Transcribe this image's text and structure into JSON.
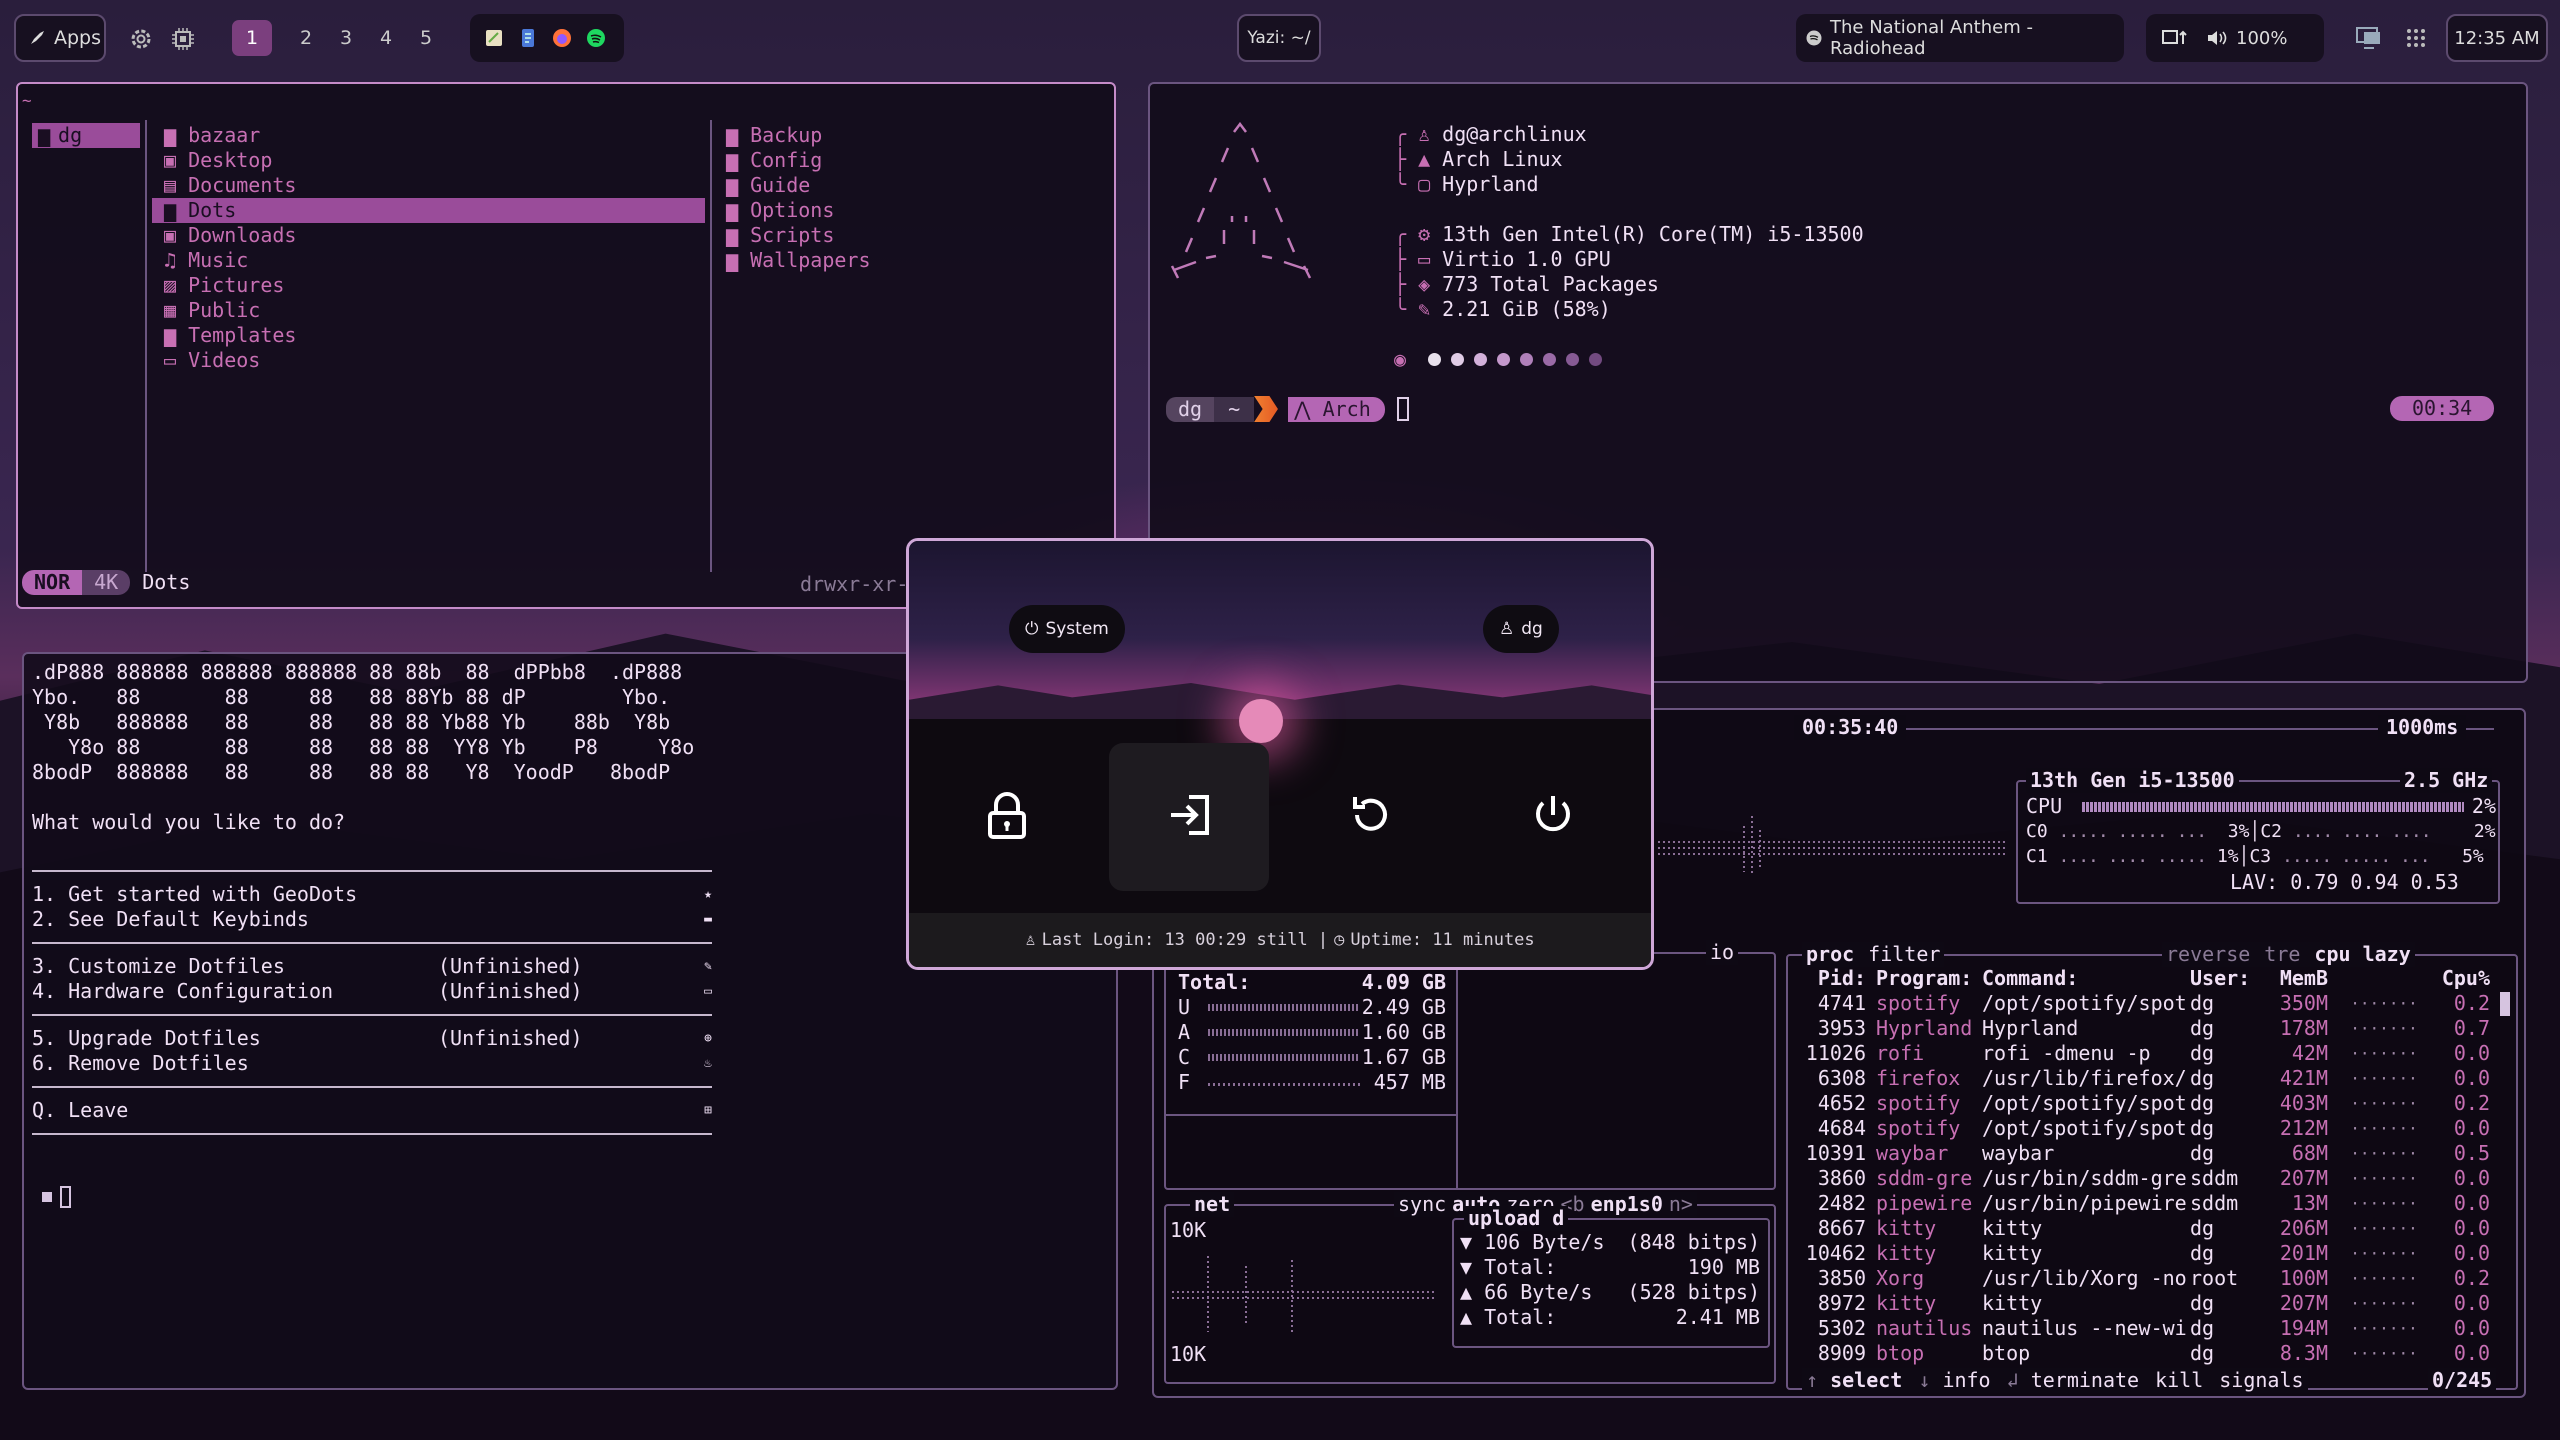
{
  "topbar": {
    "apps_label": "Apps",
    "workspaces": [
      "1",
      "2",
      "3",
      "4",
      "5"
    ],
    "active_workspace": "1",
    "window_title": "Yazi: ~/",
    "media": "The National Anthem - Radiohead",
    "volume": "100%",
    "clock": "12:35 AM"
  },
  "yazi": {
    "header": "~",
    "parent": [
      "dg"
    ],
    "current": [
      "bazaar",
      "Desktop",
      "Documents",
      "Dots",
      "Downloads",
      "Music",
      "Pictures",
      "Public",
      "Templates",
      "Videos"
    ],
    "current_selected": "Dots",
    "preview": [
      "Backup",
      "Config",
      "Guide",
      "Options",
      "Scripts",
      "Wallpapers"
    ],
    "mode": "NOR",
    "size": "4K",
    "status_name": "Dots",
    "perms": "drwxr-xr-"
  },
  "fetch": {
    "ascii": [
      "    /\\",
      "   /  \\",
      "  /    \\",
      " /      \\",
      "/   ,,   \\",
      "/   |  |  \\",
      "/_-''    ''-_\\"
    ],
    "user_host": "dg@archlinux",
    "os": "Arch Linux",
    "wm": "Hyprland",
    "cpu": "13th Gen Intel(R) Core(TM) i5-13500",
    "gpu": "Virtio 1.0 GPU",
    "packages": "773 Total Packages",
    "memory": "2.21 GiB (58%)",
    "prompt_user": "dg",
    "prompt_dir": "~",
    "prompt_os": "Arch",
    "prompt_time": "00:34"
  },
  "geodots": {
    "banner": [
      ".dP888 888888 888888 888888 88 88b  88  dPPbb8  .dP888",
      "Ybo.   88       88     88   88 88Yb 88 dP        Ybo.",
      " Y8b   888888   88     88   88 88 Yb88 Yb    88b  Y8b",
      "   Y8o 88       88     88   88 88  YY8 Yb    P8     Y8o",
      "8bodP  888888   88     88   88 88   Y8  YoodP   8bodP"
    ],
    "question": "What would you like to do?",
    "menu": [
      {
        "label": "1. Get started with GeoDots",
        "note": ""
      },
      {
        "label": "2. See Default Keybinds",
        "note": ""
      },
      {
        "label": "3. Customize Dotfiles",
        "note": "(Unfinished)"
      },
      {
        "label": "4. Hardware Configuration",
        "note": "(Unfinished)"
      },
      {
        "label": "5. Upgrade Dotfiles",
        "note": "(Unfinished)"
      },
      {
        "label": "6. Remove Dotfiles",
        "note": ""
      },
      {
        "label": "Q. Leave",
        "note": ""
      }
    ]
  },
  "power": {
    "system_label": "System",
    "user_label": "dg",
    "last_login": "Last Login: 13 00:29 still |",
    "uptime": "Uptime: 11 minutes"
  },
  "btop": {
    "time": "00:35:40",
    "interval": "1000ms",
    "cpu_name": "13th Gen i5-13500",
    "cpu_freq": "2.5 GHz",
    "cpu_total_pct": "2%",
    "cores": [
      {
        "name": "C0",
        "pct": "3%"
      },
      {
        "name": "C2",
        "pct": "2%"
      },
      {
        "name": "C1",
        "pct": "1%"
      },
      {
        "name": "C3",
        "pct": "5%"
      }
    ],
    "lav": "LAV: 0.79 0.94 0.53",
    "mem_total_label": "Total:",
    "mem_total": "4.09 GB",
    "mem_rows": [
      {
        "k": "U",
        "v": "2.49 GB"
      },
      {
        "k": "A",
        "v": "1.60 GB"
      },
      {
        "k": "C",
        "v": "1.67 GB"
      },
      {
        "k": "F",
        "v": "457 MB"
      }
    ],
    "io_label": "io",
    "net": {
      "title": "net",
      "sync": "sync",
      "auto": "auto",
      "zero": "zero",
      "b": "<b",
      "iface": "enp1s0",
      "n": "n>",
      "scale_top": "10K",
      "scale_bottom": "10K",
      "upload_label": "upload",
      "download_label": "d",
      "rows": [
        {
          "arrow": "▼",
          "label": "106 Byte/s",
          "value": "(848 bitps)"
        },
        {
          "arrow": "▼",
          "label": "Total:",
          "value": "190 MB"
        },
        {
          "arrow": "▲",
          "label": "66 Byte/s",
          "value": "(528 bitps)"
        },
        {
          "arrow": "▲",
          "label": "Total:",
          "value": "2.41 MB"
        }
      ]
    },
    "proc_tabs": {
      "proc": "proc",
      "filter": "filter",
      "reverse": "reverse",
      "tree": "tre",
      "cpu": "cpu lazy"
    },
    "columns": [
      "Pid:",
      "Program:",
      "Command:",
      "User:",
      "MemB",
      "Cpu%"
    ],
    "processes": [
      {
        "pid": "4741",
        "prog": "spotify",
        "cmd": "/opt/spotify/spot",
        "user": "dg",
        "mem": "350M",
        "cpu": "0.2"
      },
      {
        "pid": "3953",
        "prog": "Hyprland",
        "cmd": "Hyprland",
        "user": "dg",
        "mem": "178M",
        "cpu": "0.7"
      },
      {
        "pid": "11026",
        "prog": "rofi",
        "cmd": "rofi -dmenu -p",
        "user": "dg",
        "mem": "42M",
        "cpu": "0.0"
      },
      {
        "pid": "6308",
        "prog": "firefox",
        "cmd": "/usr/lib/firefox/",
        "user": "dg",
        "mem": "421M",
        "cpu": "0.0"
      },
      {
        "pid": "4652",
        "prog": "spotify",
        "cmd": "/opt/spotify/spot",
        "user": "dg",
        "mem": "403M",
        "cpu": "0.2"
      },
      {
        "pid": "4684",
        "prog": "spotify",
        "cmd": "/opt/spotify/spot",
        "user": "dg",
        "mem": "212M",
        "cpu": "0.0"
      },
      {
        "pid": "10391",
        "prog": "waybar",
        "cmd": "waybar",
        "user": "dg",
        "mem": "68M",
        "cpu": "0.5"
      },
      {
        "pid": "3860",
        "prog": "sddm-gre",
        "cmd": "/usr/bin/sddm-gre",
        "user": "sddm",
        "mem": "207M",
        "cpu": "0.0"
      },
      {
        "pid": "2482",
        "prog": "pipewire",
        "cmd": "/usr/bin/pipewire",
        "user": "sddm",
        "mem": "13M",
        "cpu": "0.0"
      },
      {
        "pid": "8667",
        "prog": "kitty",
        "cmd": "kitty",
        "user": "dg",
        "mem": "206M",
        "cpu": "0.0"
      },
      {
        "pid": "10462",
        "prog": "kitty",
        "cmd": "kitty",
        "user": "dg",
        "mem": "201M",
        "cpu": "0.0"
      },
      {
        "pid": "3850",
        "prog": "Xorg",
        "cmd": "/usr/lib/Xorg -no",
        "user": "root",
        "mem": "100M",
        "cpu": "0.2"
      },
      {
        "pid": "8972",
        "prog": "kitty",
        "cmd": "kitty",
        "user": "dg",
        "mem": "207M",
        "cpu": "0.0"
      },
      {
        "pid": "5302",
        "prog": "nautilus",
        "cmd": "nautilus --new-wi",
        "user": "dg",
        "mem": "194M",
        "cpu": "0.0"
      },
      {
        "pid": "8909",
        "prog": "btop",
        "cmd": "btop",
        "user": "dg",
        "mem": "8.3M",
        "cpu": "0.0"
      }
    ],
    "footer": {
      "select": "select",
      "info": "info",
      "terminate": "terminate",
      "kill": "kill",
      "signals": "signals",
      "count": "0/245"
    }
  }
}
